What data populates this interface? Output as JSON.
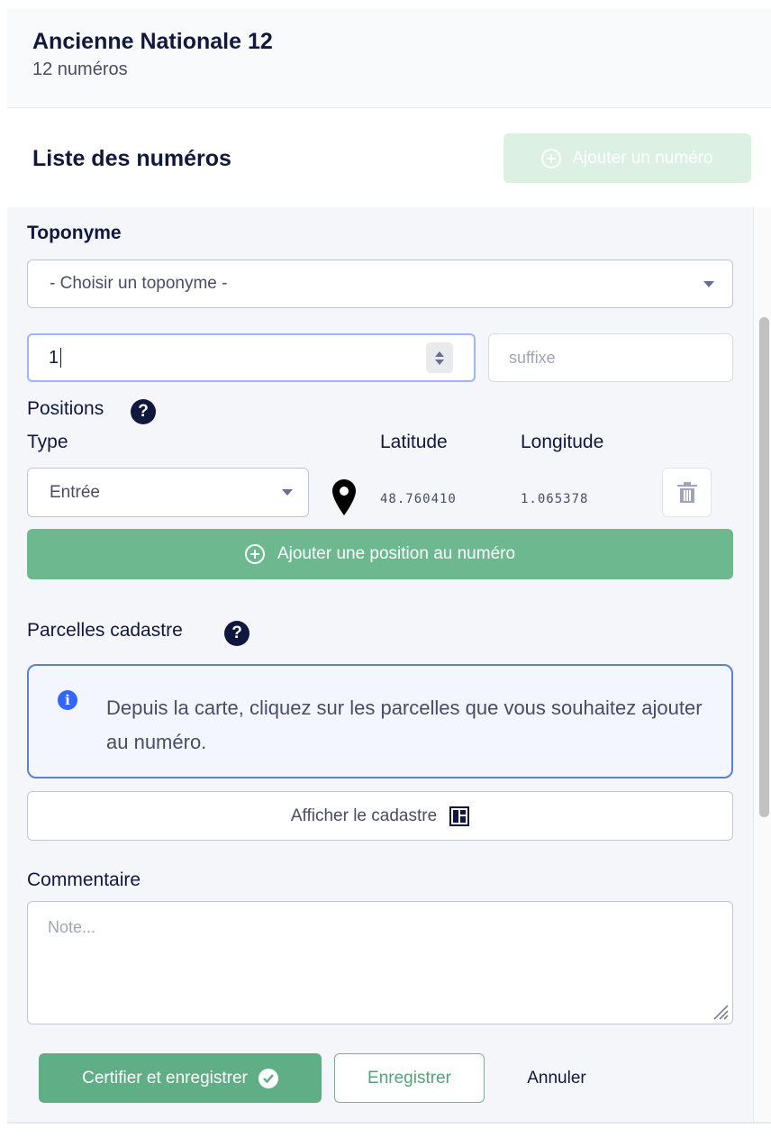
{
  "header": {
    "title": "Ancienne Nationale 12",
    "subtitle": "12 numéros"
  },
  "list": {
    "label": "Liste des numéros",
    "add_button": "Ajouter un numéro"
  },
  "form": {
    "toponyme_label": "Toponyme",
    "toponyme_selected": "- Choisir un toponyme -",
    "number_value": "1",
    "suffix_placeholder": "suffixe",
    "positions_label": "Positions",
    "col_type": "Type",
    "col_latitude": "Latitude",
    "col_longitude": "Longitude",
    "position": {
      "type": "Entrée",
      "latitude": "48.760410",
      "longitude": "1.065378"
    },
    "add_position_button": "Ajouter une position au numéro",
    "parcelles_label": "Parcelles cadastre",
    "info_message": "Depuis la carte, cliquez sur les parcelles que vous souhaitez ajouter au numéro.",
    "show_cadastre_button": "Afficher le cadastre",
    "comment_label": "Commentaire",
    "comment_placeholder": "Note...",
    "help_glyph": "?",
    "info_glyph": "i"
  },
  "actions": {
    "certify": "Certifier et enregistrer",
    "save": "Enregistrer",
    "cancel": "Annuler"
  },
  "icons": {
    "add": "plus-circle-icon",
    "help": "question-circle-icon",
    "pin": "map-marker-icon",
    "trash": "trash-icon",
    "info": "info-circle-icon",
    "cadastre": "layout-panel-icon",
    "check": "check-circle-icon"
  },
  "colors": {
    "primary_green": "#6db88f",
    "info_blue": "#3366ff",
    "text_dark": "#101840"
  }
}
